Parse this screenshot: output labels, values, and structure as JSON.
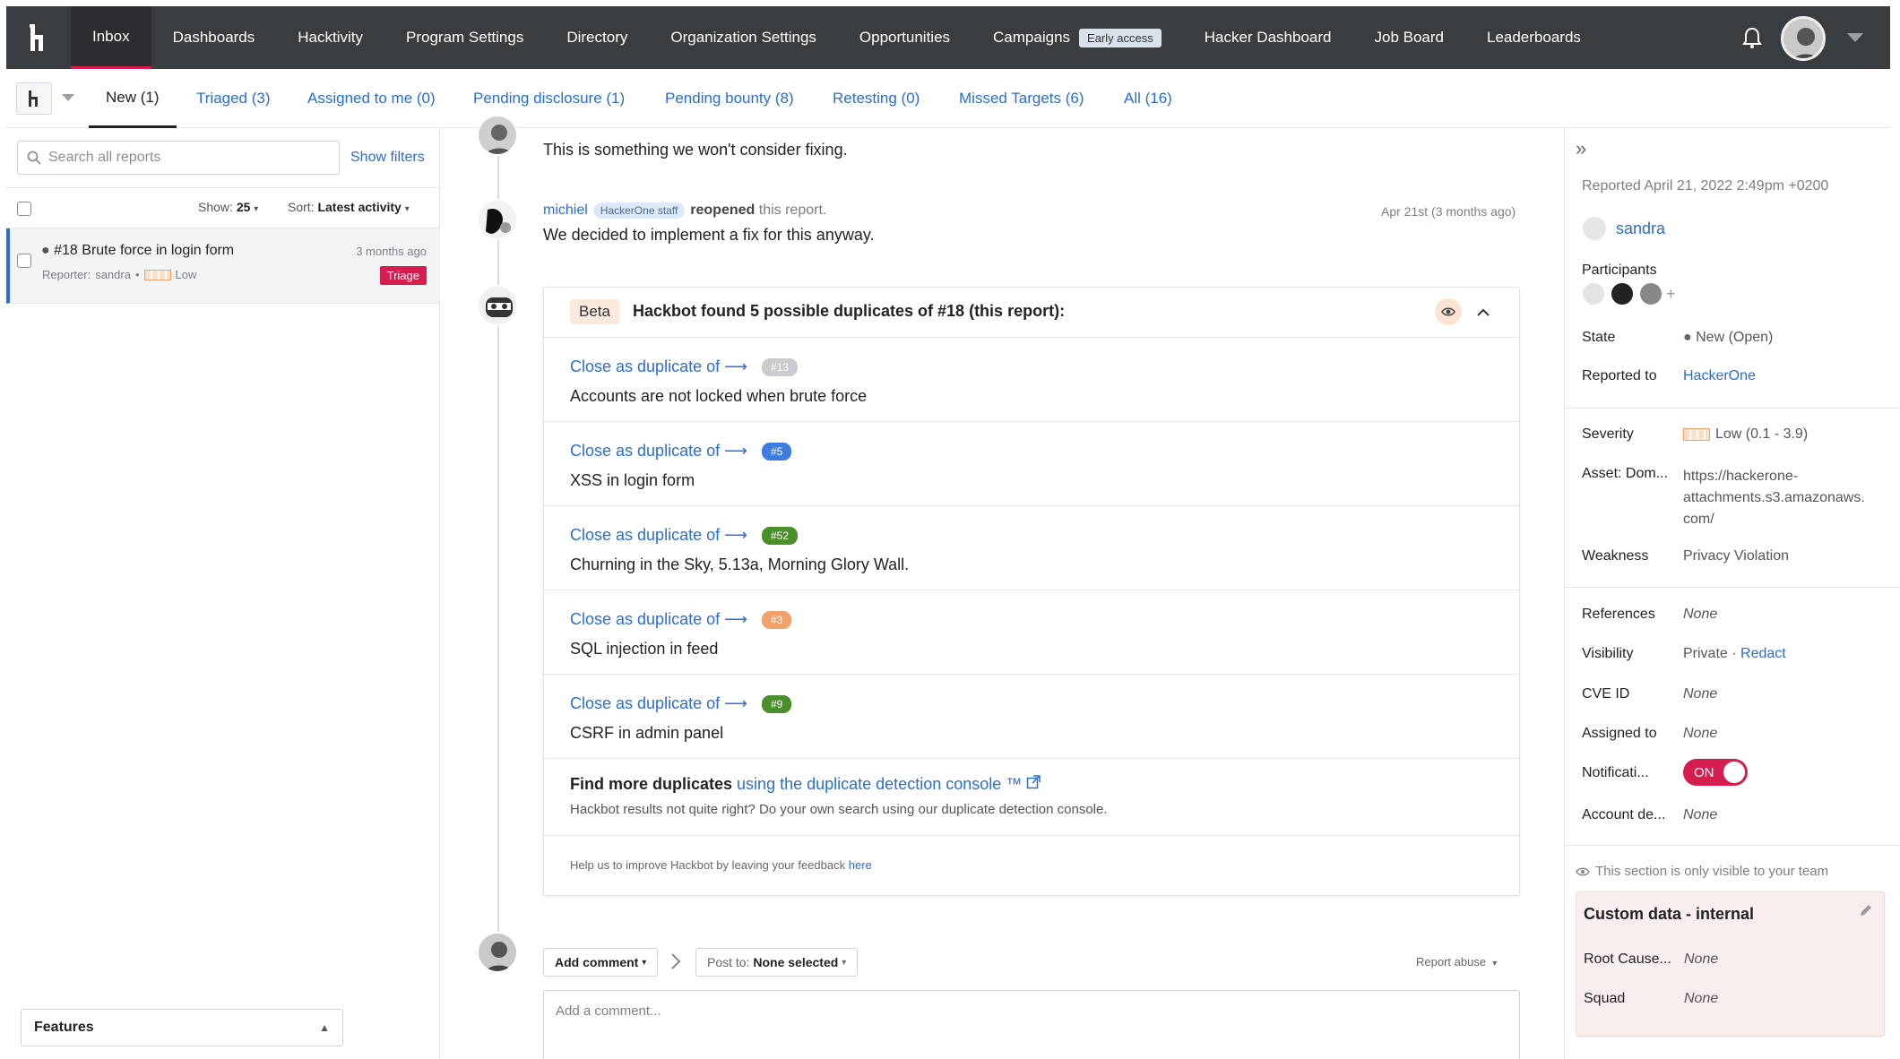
{
  "nav": {
    "items": [
      "Inbox",
      "Dashboards",
      "Hacktivity",
      "Program Settings",
      "Directory",
      "Organization Settings",
      "Opportunities",
      "Campaigns",
      "Hacker Dashboard",
      "Job Board",
      "Leaderboards"
    ],
    "early_access": "Early access"
  },
  "tabs": [
    "New (1)",
    "Triaged (3)",
    "Assigned to me (0)",
    "Pending disclosure (1)",
    "Pending bounty (8)",
    "Retesting (0)",
    "Missed Targets (6)",
    "All (16)"
  ],
  "left": {
    "search_placeholder": "Search all reports",
    "show_filters": "Show filters",
    "show_label": "Show:",
    "show_value": "25",
    "sort_label": "Sort:",
    "sort_value": "Latest activity",
    "report": {
      "title": "#18 Brute force in login form",
      "time": "3 months ago",
      "reporter_label": "Reporter:",
      "reporter": "sandra",
      "severity": "Low",
      "status": "Triage"
    },
    "features": "Features"
  },
  "timeline": {
    "prev_text": "This is something we won't consider fixing.",
    "michiel": {
      "name": "michiel",
      "badge": "HackerOne staff",
      "action": "reopened",
      "action_rest": "this report.",
      "time": "Apr 21st (3 months ago)",
      "text": "We decided to implement a fix for this anyway."
    }
  },
  "hackbot": {
    "beta": "Beta",
    "heading": "Hackbot found 5 possible duplicates of #18 (this report):",
    "close_label": "Close as duplicate of ⟶",
    "duplicates": [
      {
        "num": "#13",
        "title": "Accounts are not locked when brute force",
        "color": "#c9cbce"
      },
      {
        "num": "#5",
        "title": "XSS in login form",
        "color": "#3f7ce0"
      },
      {
        "num": "#52",
        "title": "Churning in the Sky, 5.13a, Morning Glory Wall.",
        "color": "#4a8f2a"
      },
      {
        "num": "#3",
        "title": "SQL injection in feed",
        "color": "#f0a26a"
      },
      {
        "num": "#9",
        "title": "CSRF in admin panel",
        "color": "#4a8f2a"
      }
    ],
    "find_more": "Find more duplicates",
    "find_more_link": "using the duplicate detection console ™",
    "find_more_sub": "Hackbot results not quite right? Do your own search using our duplicate detection console.",
    "feedback": "Help us to improve Hackbot by leaving your feedback",
    "feedback_link": "here"
  },
  "composer": {
    "add_comment": "Add comment",
    "post_to_label": "Post to:",
    "post_to_value": "None selected",
    "report_abuse": "Report abuse",
    "placeholder": "Add a comment..."
  },
  "right": {
    "reported": "Reported April 21, 2022 2:49pm +0200",
    "reporter": "sandra",
    "participants": "Participants",
    "state_label": "State",
    "state_value": "New (Open)",
    "reported_to_label": "Reported to",
    "reported_to_value": "HackerOne",
    "severity_label": "Severity",
    "severity_value": "Low (0.1 - 3.9)",
    "asset_label": "Asset: Dom...",
    "asset_value_1": "https://hackerone-",
    "asset_value_2": "attachments.s3.amazonaws.",
    "asset_value_3": "com/",
    "weakness_label": "Weakness",
    "weakness_value": "Privacy Violation",
    "references_label": "References",
    "references_value": "None",
    "visibility_label": "Visibility",
    "visibility_value": "Private",
    "visibility_link": "Redact",
    "cve_label": "CVE ID",
    "cve_value": "None",
    "assigned_label": "Assigned to",
    "assigned_value": "None",
    "notif_label": "Notificati...",
    "notif_value": "ON",
    "account_label": "Account de...",
    "account_value": "None",
    "team_note": "This section is only visible to your team",
    "custom_title": "Custom data - internal",
    "root_label": "Root Cause...",
    "root_value": "None",
    "squad_label": "Squad",
    "squad_value": "None"
  }
}
